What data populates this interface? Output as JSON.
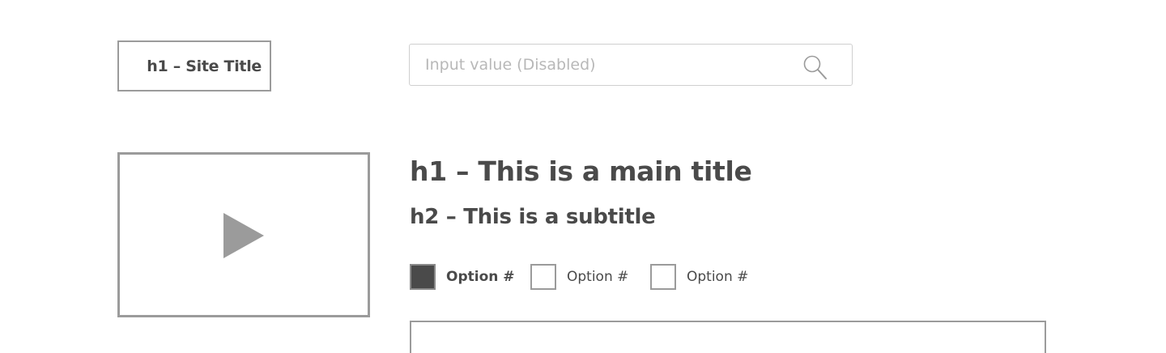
{
  "header": {
    "site_title": "h1 – Site Title",
    "search": {
      "placeholder": "Input value (Disabled)",
      "icon": "search-icon"
    }
  },
  "media": {
    "icon": "play-icon"
  },
  "content": {
    "main_title": "h1 – This is a main title",
    "subtitle": "h2 – This is a subtitle",
    "options": [
      {
        "label": "Option #",
        "checked": true
      },
      {
        "label": "Option #",
        "checked": false
      },
      {
        "label": "Option #",
        "checked": false
      }
    ]
  },
  "colors": {
    "text": "#4a4a4a",
    "border": "#9b9b9b",
    "placeholder": "#b8b8b8",
    "checked_fill": "#4a4a4a"
  }
}
